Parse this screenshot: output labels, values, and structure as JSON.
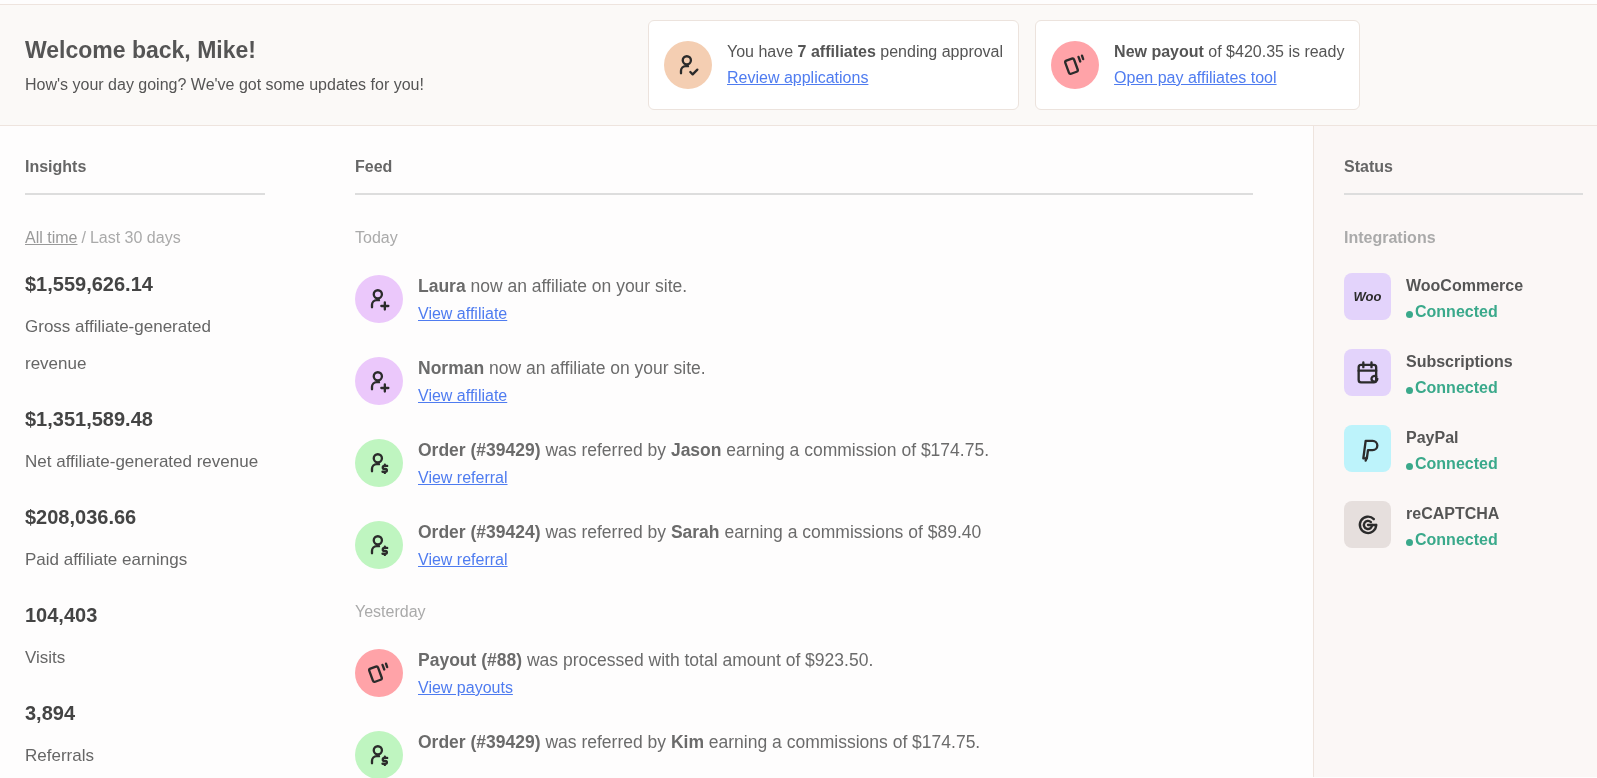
{
  "header": {
    "title": "Welcome back, Mike!",
    "subtitle": "How's your day going? We've got some updates for you!",
    "notices": [
      {
        "kind": "applications",
        "text": "You have **7 affiliates** pending approval",
        "link": "Review applications"
      },
      {
        "kind": "payout",
        "text": "**New payout** of $420.35 is ready",
        "link": "Open pay affiliates tool"
      }
    ]
  },
  "insights": {
    "heading": "Insights",
    "period_separator": "/",
    "periods": [
      {
        "label": "All time",
        "selected": true
      },
      {
        "label": "Last 30 days",
        "selected": false
      }
    ],
    "metrics": [
      {
        "value": "$1,559,626.14",
        "label": "Gross affiliate-generated revenue"
      },
      {
        "value": "$1,351,589.48",
        "label": "Net affiliate-generated revenue"
      },
      {
        "value": "$208,036.66",
        "label": "Paid affiliate earnings"
      },
      {
        "value": "104,403",
        "label": "Visits"
      },
      {
        "value": "3,894",
        "label": "Referrals"
      }
    ]
  },
  "feed": {
    "heading": "Feed",
    "groups": [
      {
        "label": "Today",
        "items": [
          {
            "kind": "affiliate",
            "text": "**Laura** now an affiliate on your site.",
            "link": "View affiliate"
          },
          {
            "kind": "affiliate",
            "text": "**Norman** now an affiliate on your site.",
            "link": "View affiliate"
          },
          {
            "kind": "referral",
            "text": "**Order (#39429)** was referred by **Jason** earning a commission of $174.75.",
            "link": "View referral"
          },
          {
            "kind": "referral",
            "text": "**Order (#39424)** was referred by **Sarah** earning a commissions of $89.40",
            "link": "View referral"
          }
        ]
      },
      {
        "label": "Yesterday",
        "items": [
          {
            "kind": "payout",
            "text": "**Payout (#88)** was processed with total amount of $923.50.",
            "link": "View payouts"
          },
          {
            "kind": "referral",
            "text": "**Order (#39429)** was referred by **Kim** earning a commissions of $174.75."
          }
        ]
      }
    ]
  },
  "status": {
    "heading": "Status",
    "subheading": "Integrations",
    "integrations": [
      {
        "kind": "woo",
        "logo": "Woo",
        "name": "WooCommerce",
        "status": "Connected",
        "color": "#3aa98b"
      },
      {
        "kind": "subscriptions",
        "name": "Subscriptions",
        "status": "Connected",
        "color": "#3aa98b"
      },
      {
        "kind": "paypal",
        "name": "PayPal",
        "status": "Connected",
        "color": "#3aa98b"
      },
      {
        "kind": "recaptcha",
        "name": "reCAPTCHA",
        "status": "Connected",
        "color": "#3aa98b"
      }
    ]
  }
}
